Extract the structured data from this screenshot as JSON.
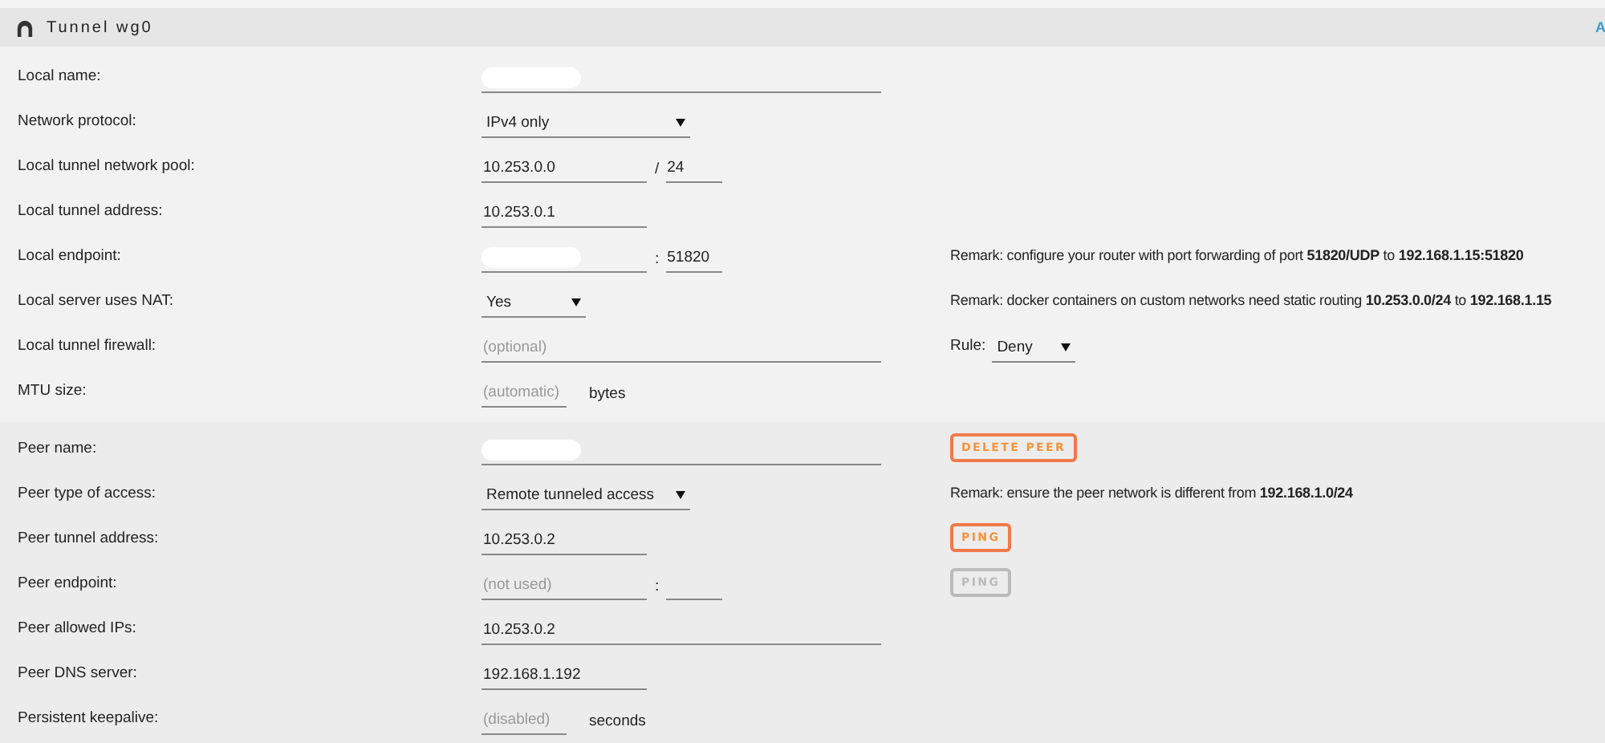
{
  "header": {
    "title": "Tunnel wg0",
    "corner_text": "A"
  },
  "sections": [
    {
      "kind": "local",
      "rows": [
        {
          "label": "Local name:",
          "field": {
            "kind": "long-text",
            "redacted": true
          }
        },
        {
          "label": "Network protocol:",
          "field": {
            "kind": "select",
            "value": "IPv4 only"
          }
        },
        {
          "label": "Local tunnel network pool:",
          "field": {
            "kind": "pair",
            "value": "10.253.0.0",
            "separator": "/",
            "second_value": "24"
          }
        },
        {
          "label": "Local tunnel address:",
          "field": {
            "kind": "text",
            "value": "10.253.0.1"
          }
        },
        {
          "label": "Local endpoint:",
          "field": {
            "kind": "pair",
            "redacted": true,
            "separator": ":",
            "second_value": "51820"
          },
          "side": {
            "kind": "remark",
            "text": "Remark: configure your router with port forwarding of port **51820/UDP** to **192.168.1.15:51820**"
          }
        },
        {
          "label": "Local server uses NAT:",
          "field": {
            "kind": "select",
            "value": "Yes"
          },
          "side": {
            "kind": "remark",
            "text": "Remark: docker containers on custom networks need static routing **10.253.0.0/24** to **192.168.1.15**"
          }
        },
        {
          "label": "Local tunnel firewall:",
          "field": {
            "kind": "long-text",
            "placeholder": "(optional)"
          },
          "side": {
            "kind": "select",
            "label": "Rule:",
            "value": "Deny"
          }
        },
        {
          "label": "MTU size:",
          "field": {
            "kind": "unit",
            "placeholder": "(automatic)",
            "unit": "bytes"
          }
        }
      ]
    },
    {
      "kind": "peer",
      "rows": [
        {
          "label": "Peer name:",
          "field": {
            "kind": "long-text",
            "redacted": true
          },
          "side": {
            "kind": "button",
            "text": "DELETE PEER",
            "disabled": false
          }
        },
        {
          "label": "Peer type of access:",
          "field": {
            "kind": "select",
            "value": "Remote tunneled access"
          },
          "side": {
            "kind": "remark",
            "text": "Remark: ensure the peer network is different from **192.168.1.0/24**"
          }
        },
        {
          "label": "Peer tunnel address:",
          "field": {
            "kind": "text",
            "value": "10.253.0.2"
          },
          "side": {
            "kind": "button",
            "text": "PING",
            "disabled": false
          }
        },
        {
          "label": "Peer endpoint:",
          "field": {
            "kind": "pair",
            "placeholder": "(not used)",
            "separator": ":"
          },
          "side": {
            "kind": "button",
            "text": "PING",
            "disabled": true
          }
        },
        {
          "label": "Peer allowed IPs:",
          "field": {
            "kind": "long-text",
            "value": "10.253.0.2"
          }
        },
        {
          "label": "Peer DNS server:",
          "field": {
            "kind": "text",
            "value": "192.168.1.192"
          }
        },
        {
          "label": "Persistent keepalive:",
          "field": {
            "kind": "unit",
            "placeholder": "(disabled)",
            "unit": "seconds"
          }
        }
      ]
    }
  ]
}
